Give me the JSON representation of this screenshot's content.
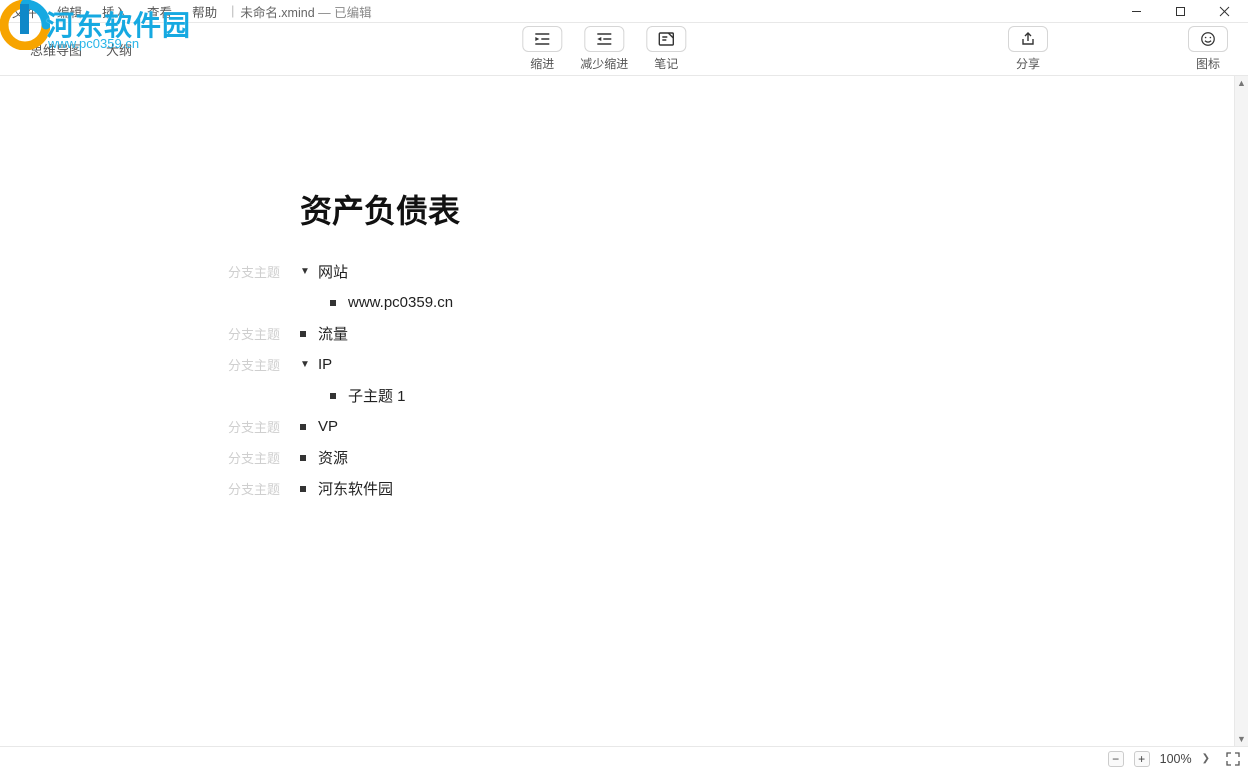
{
  "menubar": {
    "file": "文件",
    "edit": "编辑",
    "insert": "插入",
    "view": "查看",
    "help": "帮助"
  },
  "titlebar": {
    "filename": "未命名.xmind",
    "edited": "— 已编辑"
  },
  "viewtabs": {
    "mindmap": "思维导图",
    "outline": "大纲"
  },
  "toolbar": {
    "indent": "缩进",
    "outdent": "减少缩进",
    "note": "笔记",
    "share": "分享",
    "iconset": "图标"
  },
  "watermark": {
    "brand": "河东软件园",
    "url": "www.pc0359.cn"
  },
  "outline": {
    "title": "资产负债表",
    "branch_label": "分支主题",
    "items": [
      {
        "type": "parent",
        "text": "网站",
        "expanded": true,
        "children": [
          {
            "text": "www.pc0359.cn"
          }
        ]
      },
      {
        "type": "leaf",
        "text": "流量"
      },
      {
        "type": "parent",
        "text": "IP",
        "expanded": true,
        "children": [
          {
            "text": "子主题 1"
          }
        ]
      },
      {
        "type": "leaf",
        "text": "VP"
      },
      {
        "type": "leaf",
        "text": "资源"
      },
      {
        "type": "leaf",
        "text": "河东软件园"
      }
    ]
  },
  "statusbar": {
    "zoom": "100%"
  }
}
